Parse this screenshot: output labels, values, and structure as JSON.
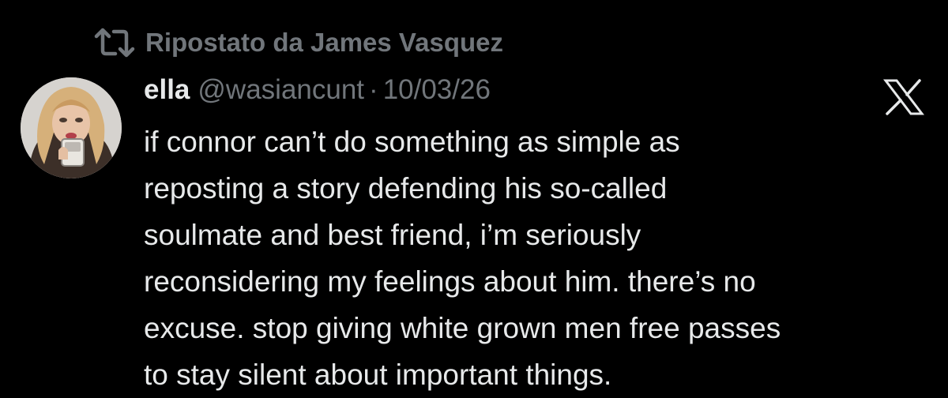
{
  "repost": {
    "label": "Ripostato da James Vasquez",
    "icon": "repost-icon"
  },
  "author": {
    "display_name": "ella",
    "handle": "@wasiancunt",
    "separator": "·",
    "date": "10/03/26"
  },
  "platform_logo": "x-logo-icon",
  "tweet": {
    "lines": [
      "if connor can’t do something as simple as",
      "reposting a story defending his so-called",
      "soulmate and best friend, i’m seriously",
      "reconsidering my feelings about him. there’s no",
      "excuse. stop giving white grown men free passes",
      "to stay silent about important things."
    ]
  },
  "colors": {
    "background": "#000000",
    "primary_text": "#e7e9ea",
    "secondary_text": "#71767b"
  }
}
